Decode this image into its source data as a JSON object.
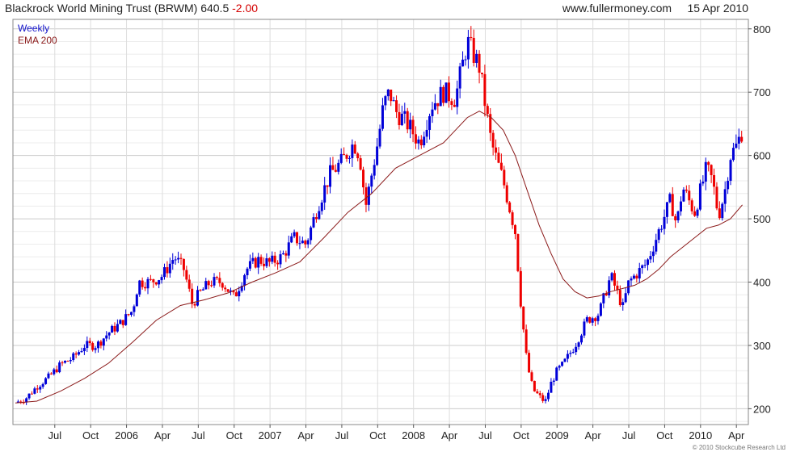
{
  "header": {
    "title": "Blackrock World Mining Trust (BRWM)",
    "price": "640.5",
    "change": "-2.00",
    "website": "www.fullermoney.com",
    "date": "15 Apr 2010"
  },
  "footer": {
    "copyright": "© 2010 Stockcube Research Ltd"
  },
  "colors": {
    "up": "#0000d8",
    "down": "#ee0000",
    "ema": "#8b1a1a",
    "grid": "#dddddd",
    "frame": "#888888",
    "wick_up": "#0000d8"
  },
  "chart_data": {
    "type": "candlestick",
    "frequency": "weekly",
    "legend": [
      "Weekly",
      "EMA 200"
    ],
    "legend_position": "top-left",
    "grid": true,
    "x_tick_labels": [
      "Jul",
      "Oct",
      "2006",
      "Apr",
      "Jul",
      "Oct",
      "2007",
      "Apr",
      "Jul",
      "Oct",
      "2008",
      "Apr",
      "Jul",
      "Oct",
      "2009",
      "Apr",
      "Jul",
      "Oct",
      "2010",
      "Apr"
    ],
    "x_tick_positions": [
      3.5,
      6.5,
      9.5,
      12.5,
      15.5,
      18.5,
      21.5,
      24.5,
      27.5,
      30.5,
      33.5,
      36.5,
      39.5,
      42.5,
      45.5,
      48.5,
      51.5,
      54.5,
      57.5,
      60.5
    ],
    "x_range": [
      0,
      61.5
    ],
    "y_tick_labels": [
      "200",
      "300",
      "400",
      "500",
      "600",
      "700",
      "800"
    ],
    "y_ticks": [
      200,
      300,
      400,
      500,
      600,
      700,
      800
    ],
    "y_range": [
      175,
      815
    ],
    "close_anchors": [
      [
        0.2,
        210
      ],
      [
        1.0,
        215
      ],
      [
        2.0,
        235
      ],
      [
        3.0,
        250
      ],
      [
        4.0,
        270
      ],
      [
        5.0,
        280
      ],
      [
        6.0,
        300
      ],
      [
        7.0,
        300
      ],
      [
        8.0,
        320
      ],
      [
        9.0,
        335
      ],
      [
        10.0,
        355
      ],
      [
        10.5,
        400
      ],
      [
        11.5,
        400
      ],
      [
        12.5,
        410
      ],
      [
        13.5,
        440
      ],
      [
        14.3,
        420
      ],
      [
        15.0,
        365
      ],
      [
        15.5,
        380
      ],
      [
        16.5,
        400
      ],
      [
        17.5,
        400
      ],
      [
        18.5,
        375
      ],
      [
        19.5,
        420
      ],
      [
        20.5,
        435
      ],
      [
        21.5,
        430
      ],
      [
        22.5,
        440
      ],
      [
        23.5,
        470
      ],
      [
        24.5,
        460
      ],
      [
        25.5,
        520
      ],
      [
        26.5,
        570
      ],
      [
        27.5,
        590
      ],
      [
        28.5,
        620
      ],
      [
        29.0,
        600
      ],
      [
        29.5,
        520
      ],
      [
        30.5,
        620
      ],
      [
        31.0,
        680
      ],
      [
        31.5,
        700
      ],
      [
        32.0,
        670
      ],
      [
        33.0,
        650
      ],
      [
        34.0,
        620
      ],
      [
        35.0,
        680
      ],
      [
        36.0,
        700
      ],
      [
        37.0,
        690
      ],
      [
        38.0,
        780
      ],
      [
        38.5,
        760
      ],
      [
        39.0,
        740
      ],
      [
        40.0,
        620
      ],
      [
        41.0,
        560
      ],
      [
        42.0,
        480
      ],
      [
        42.5,
        360
      ],
      [
        43.0,
        270
      ],
      [
        43.5,
        230
      ],
      [
        44.0,
        220
      ],
      [
        44.5,
        210
      ],
      [
        45.0,
        240
      ],
      [
        45.5,
        260
      ],
      [
        46.0,
        270
      ],
      [
        47.0,
        300
      ],
      [
        48.0,
        340
      ],
      [
        49.0,
        350
      ],
      [
        50.0,
        410
      ],
      [
        51.0,
        360
      ],
      [
        51.5,
        400
      ],
      [
        52.0,
        410
      ],
      [
        53.0,
        430
      ],
      [
        54.0,
        480
      ],
      [
        55.0,
        530
      ],
      [
        55.5,
        490
      ],
      [
        56.0,
        550
      ],
      [
        57.0,
        510
      ],
      [
        58.0,
        580
      ],
      [
        58.5,
        560
      ],
      [
        59.0,
        505
      ],
      [
        59.5,
        540
      ],
      [
        60.0,
        600
      ],
      [
        60.5,
        615
      ],
      [
        61.0,
        640
      ]
    ],
    "ema_200": [
      [
        0.2,
        209
      ],
      [
        2.0,
        212
      ],
      [
        4.0,
        228
      ],
      [
        6.0,
        248
      ],
      [
        8.0,
        272
      ],
      [
        10.0,
        305
      ],
      [
        12.0,
        340
      ],
      [
        14.0,
        363
      ],
      [
        16.0,
        372
      ],
      [
        18.0,
        383
      ],
      [
        20.0,
        400
      ],
      [
        22.0,
        415
      ],
      [
        24.0,
        432
      ],
      [
        26.0,
        470
      ],
      [
        28.0,
        510
      ],
      [
        30.0,
        540
      ],
      [
        32.0,
        580
      ],
      [
        34.0,
        600
      ],
      [
        36.0,
        620
      ],
      [
        37.0,
        640
      ],
      [
        38.0,
        660
      ],
      [
        39.0,
        670
      ],
      [
        40.0,
        660
      ],
      [
        41.0,
        640
      ],
      [
        42.0,
        600
      ],
      [
        43.0,
        545
      ],
      [
        44.0,
        490
      ],
      [
        45.0,
        445
      ],
      [
        46.0,
        405
      ],
      [
        47.0,
        385
      ],
      [
        48.0,
        375
      ],
      [
        49.0,
        378
      ],
      [
        50.0,
        385
      ],
      [
        51.0,
        390
      ],
      [
        52.0,
        395
      ],
      [
        53.0,
        405
      ],
      [
        54.0,
        420
      ],
      [
        55.0,
        440
      ],
      [
        56.0,
        455
      ],
      [
        57.0,
        470
      ],
      [
        58.0,
        485
      ],
      [
        59.0,
        490
      ],
      [
        60.0,
        500
      ],
      [
        61.0,
        522
      ]
    ]
  }
}
